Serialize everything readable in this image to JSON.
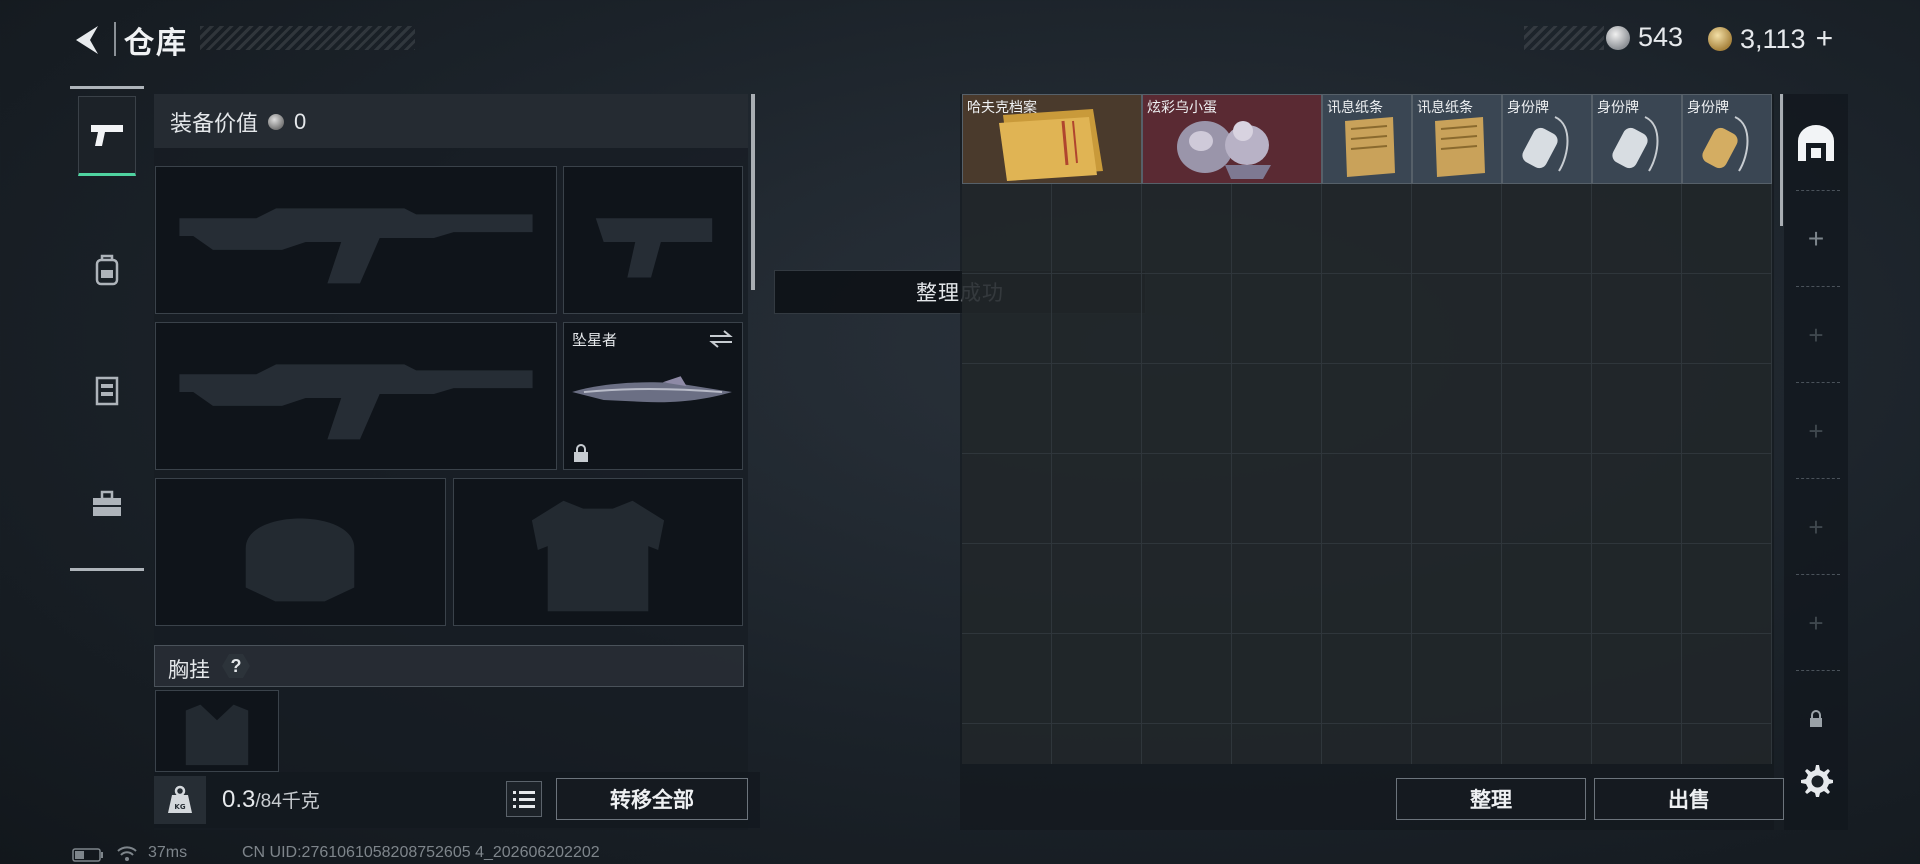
{
  "header": {
    "title": "仓库",
    "currencies": [
      {
        "icon": "silver-coin-icon",
        "value": "543"
      },
      {
        "icon": "gold-coin-icon",
        "value": "3,113"
      }
    ],
    "add_label": "+"
  },
  "rail": {
    "items": [
      {
        "name": "pistol-icon",
        "active": true
      },
      {
        "name": "backpack-icon",
        "active": false
      },
      {
        "name": "vest-icon",
        "active": false
      },
      {
        "name": "toolbox-icon",
        "active": false
      }
    ]
  },
  "equipment": {
    "value_label": "装备价值",
    "value": "0",
    "slots": [
      {
        "name": "primary-weapon-slot-1",
        "label": "",
        "ghost": "rifle"
      },
      {
        "name": "pistol-slot",
        "label": "",
        "ghost": "pistol"
      },
      {
        "name": "primary-weapon-slot-2",
        "label": "",
        "ghost": "rifle"
      },
      {
        "name": "melee-slot",
        "label": "坠星者",
        "ghost": "knife",
        "locked": true
      },
      {
        "name": "helmet-slot",
        "label": "",
        "ghost": "helmet"
      },
      {
        "name": "armor-slot",
        "label": "",
        "ghost": "armor"
      }
    ],
    "chest_rig_label": "胸挂",
    "chest_rig_help": "?"
  },
  "footer": {
    "weight_current": "0.3",
    "weight_capacity": "/84千克",
    "transfer_all": "转移全部",
    "organize": "整理",
    "sell": "出售"
  },
  "toast": "整理成功",
  "stash": {
    "items": [
      {
        "label": "哈夫克档案",
        "icon": "file-folder-icon",
        "col": 0,
        "w": 2,
        "bg": "#4a3a2c"
      },
      {
        "label": "炫彩乌小蛋",
        "icon": "egg-sculpture-icon",
        "col": 2,
        "w": 2,
        "bg": "#5a2a33"
      },
      {
        "label": "讯息纸条",
        "icon": "paper-note-icon",
        "col": 4,
        "w": 1,
        "bg": "#3a4653"
      },
      {
        "label": "讯息纸条",
        "icon": "paper-note-icon",
        "col": 5,
        "w": 1,
        "bg": "#3a4653"
      },
      {
        "label": "身份牌",
        "icon": "dog-tag-icon",
        "col": 6,
        "w": 1,
        "bg": "#3a4653"
      },
      {
        "label": "身份牌",
        "icon": "dog-tag-icon",
        "col": 7,
        "w": 1,
        "bg": "#3a4653"
      },
      {
        "label": "身份牌",
        "icon": "gold-dog-tag-icon",
        "col": 8,
        "w": 1,
        "bg": "#3a4653"
      }
    ]
  },
  "status": {
    "ping": "37ms",
    "uid": "CN UID:2761061058208752605 4_202606202202"
  }
}
